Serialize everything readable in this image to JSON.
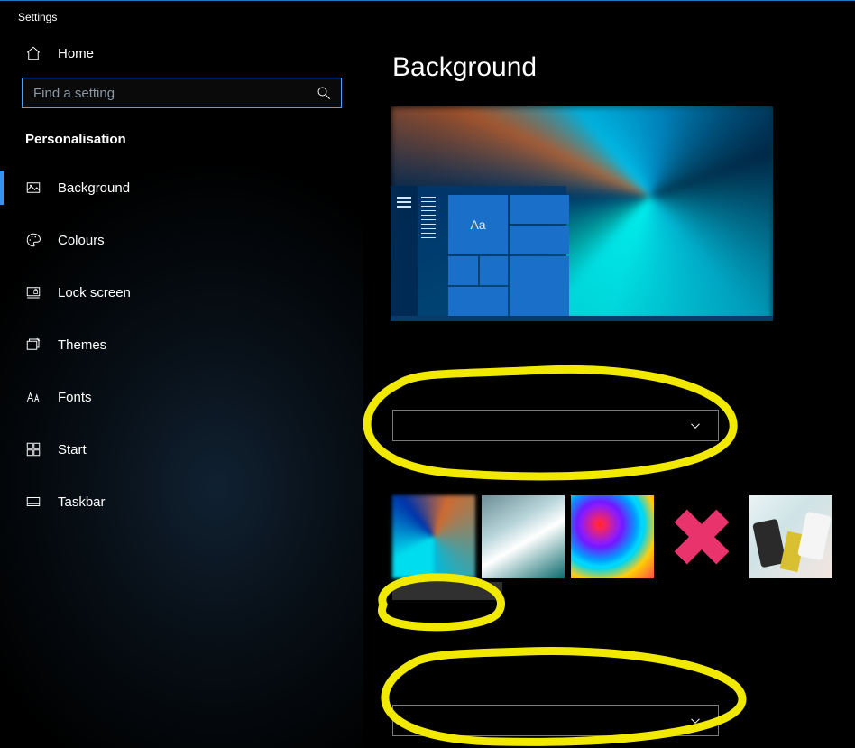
{
  "window_title": "Settings",
  "home_label": "Home",
  "search": {
    "placeholder": "Find a setting"
  },
  "category": "Personalisation",
  "sidebar": {
    "items": [
      {
        "label": "Background"
      },
      {
        "label": "Colours"
      },
      {
        "label": "Lock screen"
      },
      {
        "label": "Themes"
      },
      {
        "label": "Fonts"
      },
      {
        "label": "Start"
      },
      {
        "label": "Taskbar"
      }
    ]
  },
  "page_title": "Background",
  "preview_tile_text": "Aa",
  "dropdown1_value": "",
  "dropdown2_value": "",
  "browse_label": ""
}
